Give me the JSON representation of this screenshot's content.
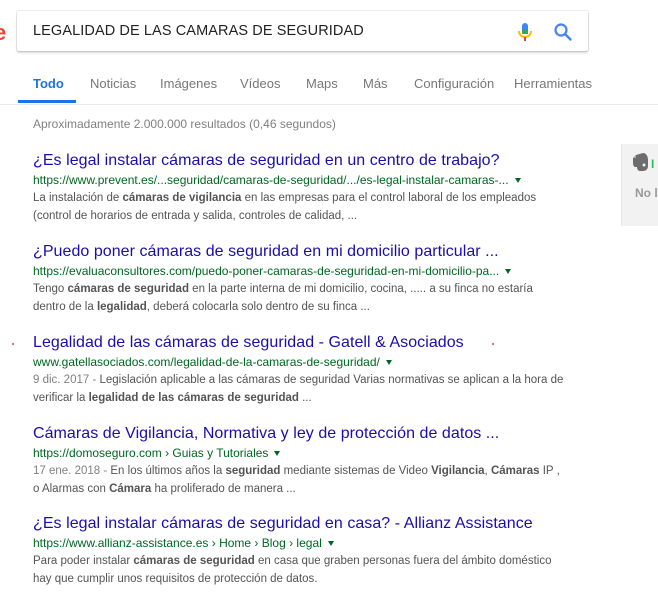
{
  "search": {
    "query": "LEGALIDAD DE LAS CAMARAS DE SEGURIDAD"
  },
  "tabs": [
    {
      "label": "Todo",
      "active": true
    },
    {
      "label": "Noticias"
    },
    {
      "label": "Imágenes"
    },
    {
      "label": "Vídeos"
    },
    {
      "label": "Maps"
    },
    {
      "label": "Más"
    },
    {
      "label": "Configuración"
    },
    {
      "label": "Herramientas"
    }
  ],
  "result_stats": "Aproximadamente 2.000.000 resultados (0,46 segundos)",
  "results": [
    {
      "title": "¿Es legal instalar cámaras de seguridad en un centro de trabajo?",
      "url": "https://www.prevent.es/...seguridad/camaras-de-seguridad/.../es-legal-instalar-camaras-...",
      "snippet_lines": [
        [
          {
            "t": "La instalación de "
          },
          {
            "t": "cámaras de vigilancia",
            "b": true
          },
          {
            "t": " en las empresas para el control laboral de los empleados"
          }
        ],
        [
          {
            "t": "(control de horarios de entrada y salida, controles de calidad, ..."
          }
        ]
      ]
    },
    {
      "title": "¿Puedo poner cámaras de seguridad en mi domicilio particular ...",
      "url": "https://evaluaconsultores.com/puedo-poner-camaras-de-seguridad-en-mi-domicilio-pa...",
      "snippet_lines": [
        [
          {
            "t": "Tengo "
          },
          {
            "t": "cámaras de seguridad",
            "b": true
          },
          {
            "t": " en la parte interna de mi domicilio, cocina, ..... a su finca no estaría"
          }
        ],
        [
          {
            "t": "dentro de la "
          },
          {
            "t": "legalidad",
            "b": true
          },
          {
            "t": ", deberá colocarla solo dentro de su finca ..."
          }
        ]
      ]
    },
    {
      "title": "Legalidad de las cámaras de seguridad - Gatell & Asociados",
      "url": "www.gatellasociados.com/legalidad-de-la-camaras-de-seguridad/",
      "snippet_lines": [
        [
          {
            "t": "9 dic. 2017 - ",
            "d": true
          },
          {
            "t": "Legislación aplicable a las cámaras de seguridad Varias normativas se aplican a la hora de"
          }
        ],
        [
          {
            "t": "verificar la "
          },
          {
            "t": "legalidad de las cámaras de seguridad",
            "b": true
          },
          {
            "t": " ..."
          }
        ]
      ]
    },
    {
      "title": "Cámaras de Vigilancia, Normativa y ley de protección de datos ...",
      "url": "https://domoseguro.com › Guias y Tutoriales",
      "snippet_lines": [
        [
          {
            "t": "17 ene. 2018 - ",
            "d": true
          },
          {
            "t": "En los últimos años la "
          },
          {
            "t": "seguridad",
            "b": true
          },
          {
            "t": " mediante sistemas de Video "
          },
          {
            "t": "Vigilancia",
            "b": true
          },
          {
            "t": ", "
          },
          {
            "t": "Cámaras",
            "b": true
          },
          {
            "t": " IP ,"
          }
        ],
        [
          {
            "t": "o Alarmas con "
          },
          {
            "t": "Cámara",
            "b": true
          },
          {
            "t": " ha proliferado de manera ..."
          }
        ]
      ]
    },
    {
      "title": "¿Es legal instalar cámaras de seguridad en casa? - Allianz Assistance",
      "url": "https://www.allianz-assistance.es › Home › Blog › legal",
      "snippet_lines": [
        [
          {
            "t": "Para poder instalar "
          },
          {
            "t": "cámaras de seguridad",
            "b": true
          },
          {
            "t": " en casa que graben personas fuera del ámbito doméstico"
          }
        ],
        [
          {
            "t": "hay que cumplir unos requisitos de protección de datos."
          }
        ]
      ]
    }
  ],
  "side_panel": {
    "green_text": "I",
    "text": "No l"
  },
  "colors": {
    "title_link": "#1a0dab",
    "url_green": "#006621",
    "snippet": "#545454",
    "tab_active": "#1a73e8"
  }
}
